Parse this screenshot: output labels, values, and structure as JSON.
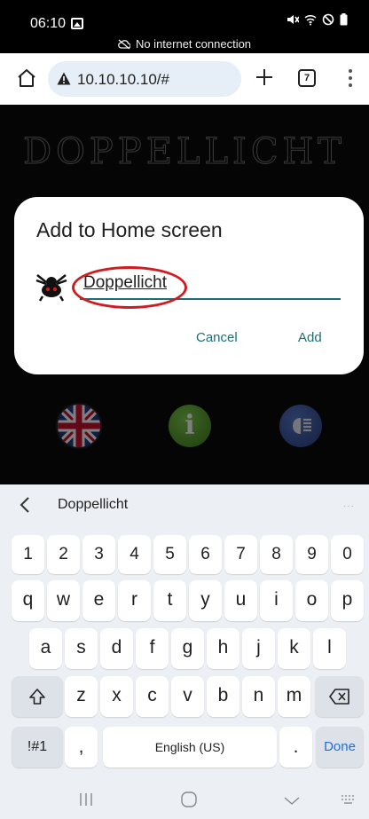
{
  "status_bar": {
    "time": "06:10",
    "connection_text": "No internet connection"
  },
  "browser": {
    "url": "10.10.10.10/#",
    "tab_count": "7"
  },
  "website": {
    "title": "DOPPELLICHT"
  },
  "dialog": {
    "title": "Add to Home screen",
    "name_value": "Doppellicht",
    "cancel_label": "Cancel",
    "add_label": "Add"
  },
  "keyboard": {
    "suggestion": "Doppellicht",
    "number_row": [
      "1",
      "2",
      "3",
      "4",
      "5",
      "6",
      "7",
      "8",
      "9",
      "0"
    ],
    "row1": [
      "q",
      "w",
      "e",
      "r",
      "t",
      "y",
      "u",
      "i",
      "o",
      "p"
    ],
    "row2": [
      "a",
      "s",
      "d",
      "f",
      "g",
      "h",
      "j",
      "k",
      "l"
    ],
    "row3": [
      "z",
      "x",
      "c",
      "v",
      "b",
      "n",
      "m"
    ],
    "symbols_label": "!#1",
    "comma": ",",
    "space_label": "English (US)",
    "period": ".",
    "done_label": "Done"
  },
  "colors": {
    "accent": "#1b6f74",
    "highlight_circle": "#d01c20",
    "done": "#1f6fd6"
  }
}
